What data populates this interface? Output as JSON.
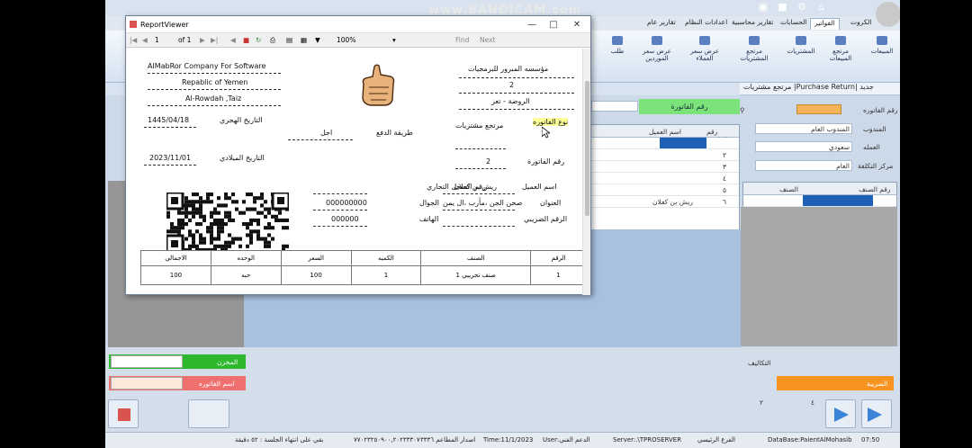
{
  "watermark": "www.BANDICAM.com",
  "menu_tabs": [
    "الكروت",
    "الفواتير",
    "الحسابات",
    "تقارير محاسبية",
    "اعدادات النظام",
    "تقارير عام"
  ],
  "ribbon_buttons": [
    "المبيعات",
    "مرتجع المبيعات",
    "المشتريات",
    "مرتجع المشتريات",
    "عرض سعر العملاء",
    "عرض سعر الموردين",
    "طلب"
  ],
  "form": {
    "title": "مرتجع مشتريات |Purchase Return| جديد",
    "invoice_number_label": "رقم الفاتورة",
    "green_label": "رقم الفاتورة",
    "labels": [
      "رقم الفاتوره",
      "المندوب",
      "العمله",
      "مركز التكلفة"
    ],
    "values": [
      "المندوب العام",
      "سعودي",
      "العام"
    ],
    "grid_headers": [
      "رقم الفاتورة",
      "اسم العميل"
    ],
    "grid_rows": [
      "١",
      "٢",
      "٣",
      "٤",
      "٥",
      "٦"
    ],
    "grid_customer": "ريش بن كعلان",
    "items_headers": [
      "رقم الصنف",
      "الصنف"
    ],
    "bottom_labels": [
      "التكاليف",
      "المخزن",
      "اسم الفاتوره",
      "الضريبة"
    ],
    "bottom_values": [
      "٢",
      "٤"
    ]
  },
  "report_viewer": {
    "title": "ReportViewer",
    "page": "1",
    "of_pages": "of 1",
    "zoom": "100%",
    "find": "Find",
    "next": "Next",
    "company_en": "AlMabRor Company For Software",
    "country_en": "Repablic of Yemen",
    "city_en": "Al-Rowdah ,Taiz",
    "company_ar": "مؤسسه المبرور للبرمجيات",
    "num_ar": "2",
    "city_ar": "الروضة - تعز",
    "hijri_label": "التاريخ الهجري",
    "hijri_value": "1445/04/18",
    "greg_label": "التاريخ الميلادي",
    "greg_value": "2023/11/01",
    "pay_label": "طريقة الدفع",
    "pay_value": "اجل",
    "doc_type": "مرتجع مشتريات",
    "invoice_type_label": "نوع الفاتوره",
    "invoice_no_label": "رقم الفاتورة",
    "invoice_no_value": "2",
    "customer_label": "اسم العميل",
    "customer_value": "ريش بن كعلان",
    "address_label": "العنوان",
    "address_value": "صحن الجن ،مأرب ،ال يمن",
    "tax_label": "الرقم الضريبي",
    "cr_label": "رقم السجل التجاري",
    "mobile_label": "الجوال",
    "mobile_value": "000000000",
    "phone_label": "الهاتف",
    "phone_value": "000000",
    "table_headers": [
      "الرقم",
      "الصنف",
      "الكميه",
      "السعر",
      "الوحده",
      "الاجمالي"
    ],
    "table_rows": [
      [
        "1",
        "صنف تجريبي 1",
        "1",
        "100",
        "حبه",
        "100"
      ]
    ]
  },
  "status": {
    "time": "07:50",
    "database": "DataBase:PaientAlMohasib",
    "branch": "الفرع الرئيسي",
    "server": "Server:.\\TPROSERVER",
    "user": "User:الدعم الفني",
    "date": "Time:11/1/2023",
    "version": "اصدار المطاعم ٣٣٣٦",
    "phone": "٧٧٠٢٣٢٥٠٩٠٠,٢٠٢٣٣٣٠٧",
    "session": "بقي على انتهاء الجلسة : ٥٢ دقيقة"
  }
}
